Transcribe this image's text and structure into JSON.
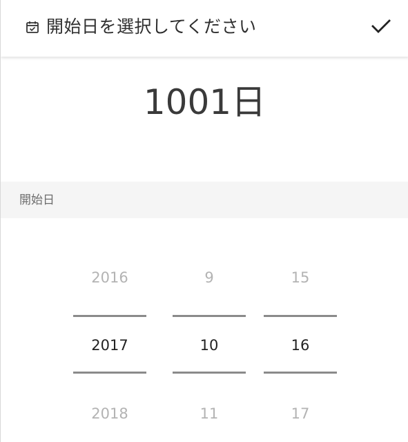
{
  "header": {
    "title": "開始日を選択してください",
    "icon": "calendar-check-icon",
    "confirm_icon": "check-icon"
  },
  "summary": {
    "day_count": "1001日"
  },
  "section": {
    "label": "開始日"
  },
  "picker": {
    "year": {
      "prev": "2016",
      "selected": "2017",
      "next": "2018"
    },
    "month": {
      "prev": "9",
      "selected": "10",
      "next": "11"
    },
    "day": {
      "prev": "15",
      "selected": "16",
      "next": "17"
    }
  }
}
